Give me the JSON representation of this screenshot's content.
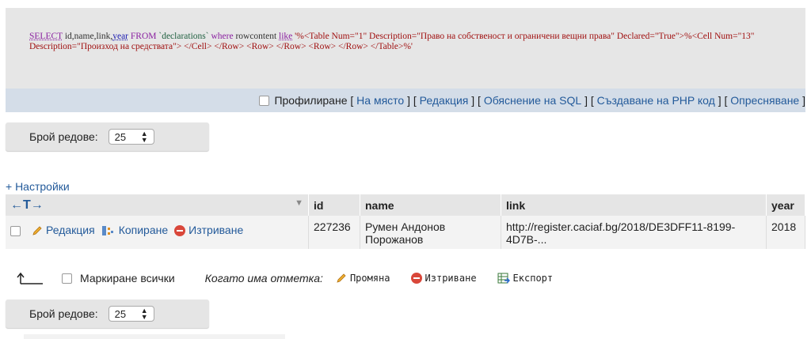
{
  "sql": {
    "select": "SELECT",
    "fields": " id,name,link,",
    "year_fn": "year",
    "from": " FROM ",
    "table": "`declarations`",
    "where": " where ",
    "column": "rowcontent ",
    "like": "like",
    "literal": " '%<Table Num=\"1\" Description=\"Право на собственост и ограничени вещни права\" Declared=\"True\">%<Cell Num=\"13\" Description=\"Произход на средствата\"> </Cell> </Row> <Row> </Row> <Row> </Row> </Table>%'"
  },
  "links_bar": {
    "profiling_label": "Профилиране",
    "inline_link": "На място",
    "edit_link": "Редакция",
    "explain_link": "Обяснение на SQL",
    "php_link": "Създаване на PHP код",
    "refresh_link": "Опресняване"
  },
  "pager_top": {
    "label": "Брой редове:",
    "value": "25"
  },
  "pager_bottom": {
    "label": "Брой редове:",
    "value": "25"
  },
  "settings_link": "+ Настройки",
  "table": {
    "nav_arrows": "←T→",
    "columns": [
      "id",
      "name",
      "link",
      "year"
    ],
    "rows": [
      {
        "edit": "Редакция",
        "copy": "Копиране",
        "delete": "Изтриване",
        "id": "227236",
        "name": "Румен Андонов Порожанов",
        "link": "http://register.caciaf.bg/2018/DE3DFF11-8199-4D7B-...",
        "year": "2018"
      }
    ]
  },
  "bulk": {
    "check_all": "Маркиране всички",
    "with_selected": "Когато има отметка:",
    "change": "Промяна",
    "delete": "Изтриване",
    "export": "Експорт"
  },
  "colors": {
    "link": "#235a9a",
    "header_bg": "#e5e5e5",
    "sql_bg": "#e6e6e6",
    "links_bg": "#d4dde8"
  }
}
